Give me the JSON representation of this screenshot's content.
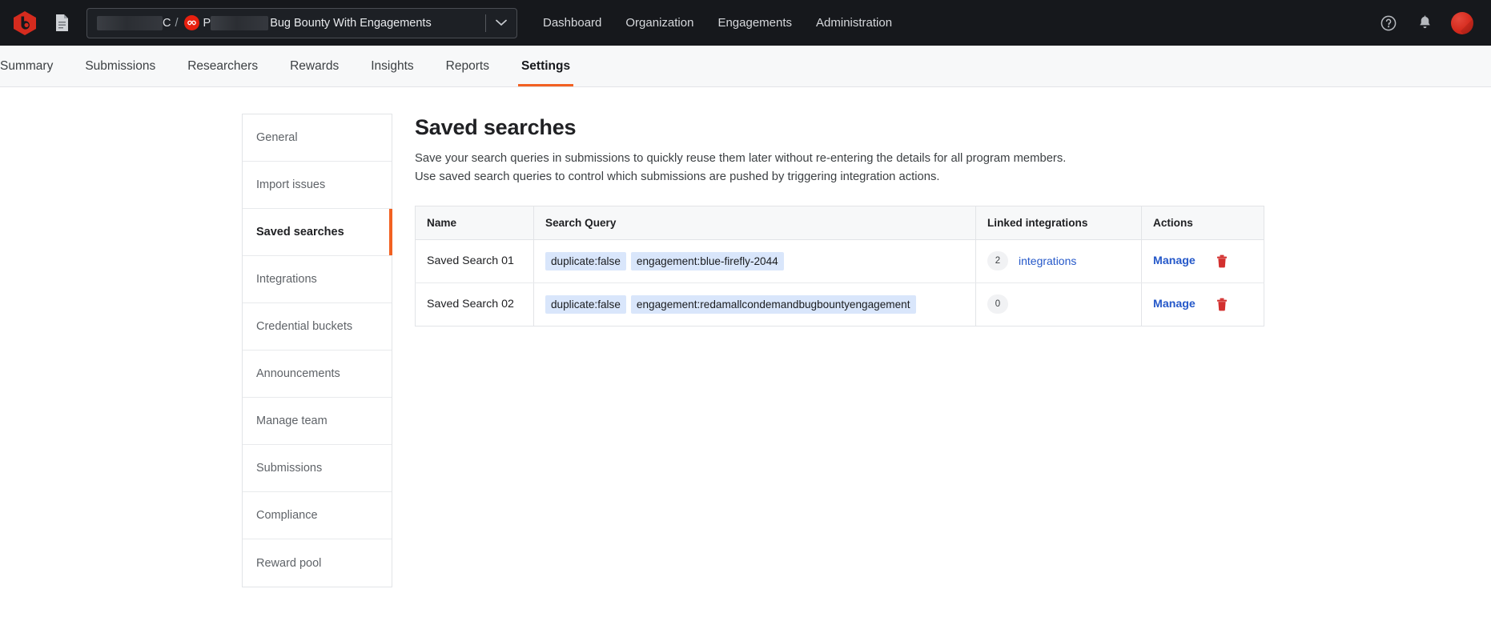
{
  "topbar": {
    "logo_icon": "bugcrowd-logo-icon",
    "doc_icon": "document-icon",
    "org_selector": {
      "redacted_org": "",
      "org_suffix": "C",
      "separator": "/",
      "engagement_icon": "engagement-circle-icon",
      "program_prefix": "P",
      "title": "Bug Bounty With Engagements",
      "caret_icon": "chevron-down-icon"
    },
    "nav": [
      {
        "label": "Dashboard"
      },
      {
        "label": "Organization"
      },
      {
        "label": "Engagements"
      },
      {
        "label": "Administration"
      }
    ],
    "help_icon": "help-circle-icon",
    "bell_icon": "notification-bell-icon",
    "avatar": "user-avatar"
  },
  "tabs": [
    {
      "label": "Summary",
      "active": false
    },
    {
      "label": "Submissions",
      "active": false
    },
    {
      "label": "Researchers",
      "active": false
    },
    {
      "label": "Rewards",
      "active": false
    },
    {
      "label": "Insights",
      "active": false
    },
    {
      "label": "Reports",
      "active": false
    },
    {
      "label": "Settings",
      "active": true
    }
  ],
  "sidebar": {
    "items": [
      {
        "label": "General",
        "active": false
      },
      {
        "label": "Import issues",
        "active": false
      },
      {
        "label": "Saved searches",
        "active": true
      },
      {
        "label": "Integrations",
        "active": false
      },
      {
        "label": "Credential buckets",
        "active": false
      },
      {
        "label": "Announcements",
        "active": false
      },
      {
        "label": "Manage team",
        "active": false
      },
      {
        "label": "Submissions",
        "active": false
      },
      {
        "label": "Compliance",
        "active": false
      },
      {
        "label": "Reward pool",
        "active": false
      }
    ]
  },
  "main": {
    "title": "Saved searches",
    "description_line1": "Save your search queries in submissions to quickly reuse them later without re-entering the details for all program members.",
    "description_line2": "Use saved search queries to control which submissions are pushed by triggering integration actions.",
    "table": {
      "headers": [
        "Name",
        "Search Query",
        "Linked integrations",
        "Actions"
      ],
      "rows": [
        {
          "name": "Saved Search 01",
          "query_tags": [
            "duplicate:false",
            "engagement:blue-firefly-2044"
          ],
          "linked_count": "2",
          "linked_label": "integrations",
          "manage_label": "Manage",
          "delete_icon": "trash-icon"
        },
        {
          "name": "Saved Search 02",
          "query_tags": [
            "duplicate:false",
            "engagement:redamallcondemandbugbountyengagement"
          ],
          "linked_count": "0",
          "linked_label": "",
          "manage_label": "Manage",
          "delete_icon": "trash-icon"
        }
      ]
    }
  },
  "colors": {
    "accent_orange": "#f26122",
    "link_blue": "#2558c9",
    "tag_blue_bg": "#d9e6fb",
    "danger_red": "#d3302f",
    "topbar_bg": "#16181c"
  }
}
